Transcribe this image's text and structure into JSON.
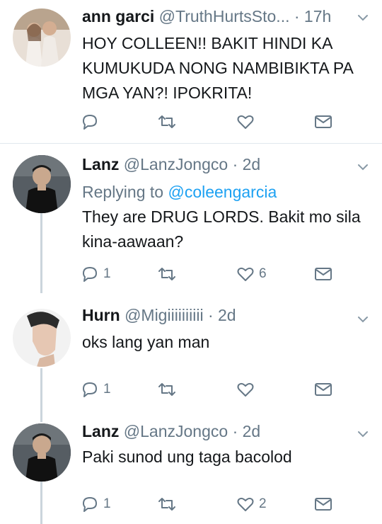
{
  "colors": {
    "link": "#1da1f2",
    "muted": "#657786",
    "text": "#14171a",
    "divider": "#e1e8ed"
  },
  "tweets": [
    {
      "name": "ann garci",
      "handle": "@TruthHurtsSto...",
      "time": "· 17h",
      "text": "HOY COLLEEN!! BAKIT HINDI KA KUMUKUDA NONG NAMBIBIKTA PA MGA YAN?! IPOKRITA!",
      "reply_count": "",
      "like_count": ""
    },
    {
      "name": "Lanz",
      "handle": "@LanzJongco",
      "time": "· 2d",
      "replying_label": "Replying to",
      "replying_to": "@coleengarcia",
      "text": "They are DRUG LORDS. Bakit mo sila kina-aawaan?",
      "reply_count": "1",
      "like_count": "6"
    },
    {
      "name": "Hurn",
      "handle": "@Migiiiiiiiiii",
      "time": "· 2d",
      "text": "oks lang yan man",
      "reply_count": "1",
      "like_count": ""
    },
    {
      "name": "Lanz",
      "handle": "@LanzJongco",
      "time": "· 2d",
      "text": "Paki sunod ung taga bacolod",
      "reply_count": "1",
      "like_count": "2"
    }
  ],
  "icons": {
    "reply": "reply-icon",
    "retweet": "retweet-icon",
    "like": "heart-icon",
    "dm": "envelope-icon",
    "caret": "chevron-down-icon"
  }
}
